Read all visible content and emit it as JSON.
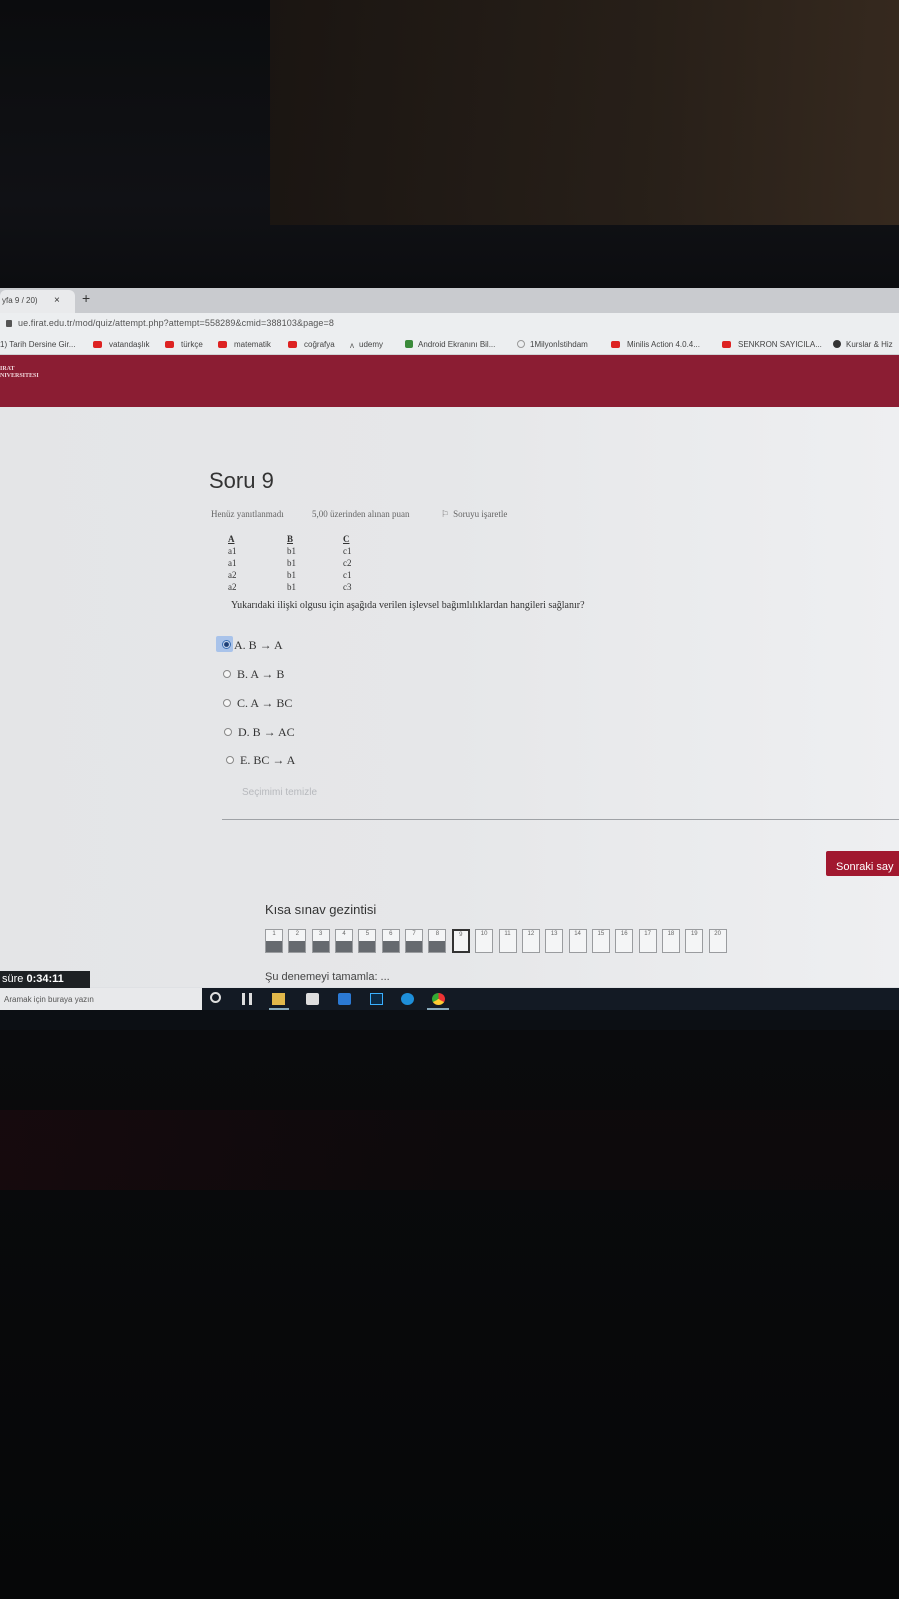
{
  "browser": {
    "tab_title": "yfa 9 / 20)",
    "tab_close": "×",
    "new_tab": "+",
    "url": "ue.firat.edu.tr/mod/quiz/attempt.php?attempt=558289&cmid=388103&page=8"
  },
  "bookmarks": [
    {
      "label": "1) Tarih Dersine Gir...",
      "icon": "page-icon"
    },
    {
      "label": "vatandaşlık",
      "icon": "youtube-icon"
    },
    {
      "label": "türkçe",
      "icon": "youtube-icon"
    },
    {
      "label": "matematik",
      "icon": "youtube-icon"
    },
    {
      "label": "coğrafya",
      "icon": "youtube-icon"
    },
    {
      "label": "udemy",
      "icon": "udemy-icon"
    },
    {
      "label": "Android Ekranını Bil...",
      "icon": "android-icon"
    },
    {
      "label": "1Milyonİstihdam",
      "icon": "globe-icon"
    },
    {
      "label": "Minilis Action 4.0.4...",
      "icon": "youtube-icon"
    },
    {
      "label": "SENKRON SAYICILA...",
      "icon": "youtube-icon"
    },
    {
      "label": "Kurslar & Hiz",
      "icon": "d-icon"
    }
  ],
  "header": {
    "logo_line1": "IRAT",
    "logo_line2": "NIVERSITESI"
  },
  "question": {
    "title": "Soru 9",
    "status": "Henüz yanıtlanmadı",
    "points": "5,00 üzerinden alınan puan",
    "flag_label": "Soruyu işaretle",
    "table": {
      "headers": [
        "A",
        "B",
        "C"
      ],
      "rows": [
        [
          "a1",
          "b1",
          "c1"
        ],
        [
          "a1",
          "b1",
          "c2"
        ],
        [
          "a2",
          "b1",
          "c1"
        ],
        [
          "a2",
          "b1",
          "c3"
        ]
      ]
    },
    "text": "Yukarıdaki ilişki olgusu için aşağıda verilen işlevsel bağımlılıklardan hangileri sağlanır?",
    "options": [
      {
        "label": "A. B → A",
        "selected": true
      },
      {
        "label": "B. A → B",
        "selected": false
      },
      {
        "label": "C. A → BC",
        "selected": false
      },
      {
        "label": "D. B → AC",
        "selected": false
      },
      {
        "label": "E. BC → A",
        "selected": false
      }
    ],
    "clear_label": "Seçimimi temizle"
  },
  "next_button": "Sonraki say",
  "quiz_nav": {
    "title": "Kısa sınav gezintisi",
    "current": 9,
    "pages": [
      "1",
      "2",
      "3",
      "4",
      "5",
      "6",
      "7",
      "8",
      "9",
      "10",
      "11",
      "12",
      "13",
      "14",
      "15",
      "16",
      "17",
      "18",
      "19",
      "20"
    ],
    "answered": [
      1,
      2,
      3,
      4,
      5,
      6,
      7,
      8
    ]
  },
  "timer": {
    "prefix": "süre",
    "value": "0:34:11"
  },
  "finish_label": "Şu denemeyi tamamla: ...",
  "taskbar": {
    "search_placeholder": "Aramak için buraya yazın",
    "icons": [
      "cortana-icon",
      "task-view-icon",
      "file-explorer-icon",
      "store-icon",
      "mail-icon",
      "photoshop-icon",
      "edge-icon",
      "chrome-icon"
    ]
  },
  "colors": {
    "brand": "#8b1d33",
    "button": "#a1182f",
    "selected": "#a9c3ea"
  }
}
